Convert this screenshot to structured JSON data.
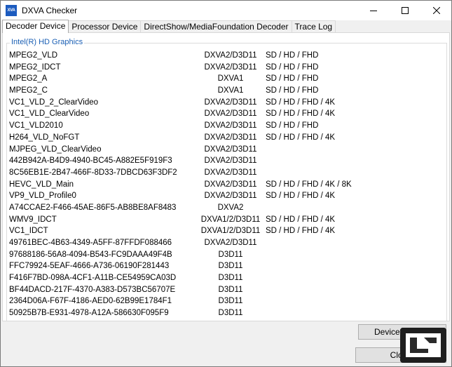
{
  "window": {
    "title": "DXVA Checker",
    "icon_text": "XVA"
  },
  "tabs": [
    {
      "label": "Decoder Device"
    },
    {
      "label": "Processor Device"
    },
    {
      "label": "DirectShow/MediaFoundation Decoder"
    },
    {
      "label": "Trace Log"
    }
  ],
  "group": {
    "label": "Intel(R) HD Graphics"
  },
  "decoders": [
    {
      "name": "MPEG2_VLD",
      "api": "DXVA2/D3D11",
      "resolutions": "SD / HD / FHD"
    },
    {
      "name": "MPEG2_IDCT",
      "api": "DXVA2/D3D11",
      "resolutions": "SD / HD / FHD"
    },
    {
      "name": "MPEG2_A",
      "api": "DXVA1",
      "resolutions": "SD / HD / FHD"
    },
    {
      "name": "MPEG2_C",
      "api": "DXVA1",
      "resolutions": "SD / HD / FHD"
    },
    {
      "name": "VC1_VLD_2_ClearVideo",
      "api": "DXVA2/D3D11",
      "resolutions": "SD / HD / FHD / 4K"
    },
    {
      "name": "VC1_VLD_ClearVideo",
      "api": "DXVA2/D3D11",
      "resolutions": "SD / HD / FHD / 4K"
    },
    {
      "name": "VC1_VLD2010",
      "api": "DXVA2/D3D11",
      "resolutions": "SD / HD / FHD"
    },
    {
      "name": "H264_VLD_NoFGT",
      "api": "DXVA2/D3D11",
      "resolutions": "SD / HD / FHD / 4K"
    },
    {
      "name": "MJPEG_VLD_ClearVideo",
      "api": "DXVA2/D3D11",
      "resolutions": ""
    },
    {
      "name": "442B942A-B4D9-4940-BC45-A882E5F919F3",
      "api": "DXVA2/D3D11",
      "resolutions": ""
    },
    {
      "name": "8C56EB1E-2B47-466F-8D33-7DBCD63F3DF2",
      "api": "DXVA2/D3D11",
      "resolutions": ""
    },
    {
      "name": "HEVC_VLD_Main",
      "api": "DXVA2/D3D11",
      "resolutions": "SD / HD / FHD / 4K / 8K"
    },
    {
      "name": "VP9_VLD_Profile0",
      "api": "DXVA2/D3D11",
      "resolutions": "SD / HD / FHD / 4K"
    },
    {
      "name": "A74CCAE2-F466-45AE-86F5-AB8BE8AF8483",
      "api": "DXVA2",
      "resolutions": ""
    },
    {
      "name": "WMV9_IDCT",
      "api": "DXVA1/2/D3D11",
      "resolutions": "SD / HD / FHD / 4K"
    },
    {
      "name": "VC1_IDCT",
      "api": "DXVA1/2/D3D11",
      "resolutions": "SD / HD / FHD / 4K"
    },
    {
      "name": "49761BEC-4B63-4349-A5FF-87FFDF088466",
      "api": "DXVA2/D3D11",
      "resolutions": ""
    },
    {
      "name": "97688186-56A8-4094-B543-FC9DAAA49F4B",
      "api": "D3D11",
      "resolutions": ""
    },
    {
      "name": "FFC79924-5EAF-4666-A736-06190F281443",
      "api": "D3D11",
      "resolutions": ""
    },
    {
      "name": "F416F7BD-098A-4CF1-A11B-CE54959CA03D",
      "api": "D3D11",
      "resolutions": ""
    },
    {
      "name": "BF44DACD-217F-4370-A383-D573BC56707E",
      "api": "D3D11",
      "resolutions": ""
    },
    {
      "name": "2364D06A-F67F-4186-AED0-62B99E1784F1",
      "api": "D3D11",
      "resolutions": ""
    },
    {
      "name": "50925B7B-E931-4978-A12A-586630F095F9",
      "api": "D3D11",
      "resolutions": ""
    }
  ],
  "buttons": {
    "device_creator": "Device Creator",
    "close": "Close"
  },
  "watermark": {
    "icon": "legit-reviews-logo-icon"
  }
}
